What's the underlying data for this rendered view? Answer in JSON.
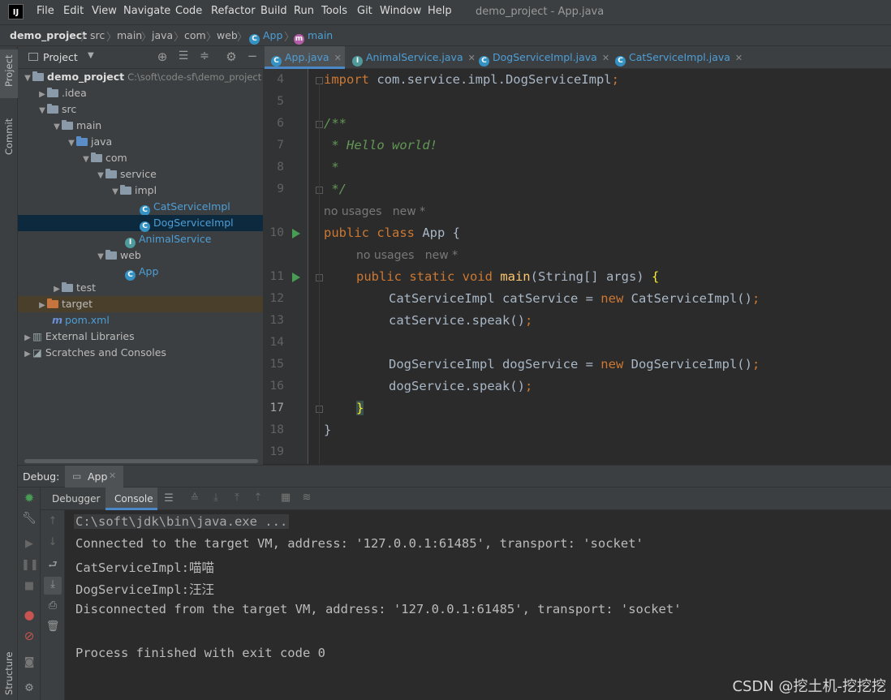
{
  "menu": {
    "items": [
      "File",
      "Edit",
      "View",
      "Navigate",
      "Code",
      "Refactor",
      "Build",
      "Run",
      "Tools",
      "Git",
      "Window",
      "Help"
    ],
    "window_title": "demo_project - App.java"
  },
  "breadcrumb": [
    "demo_project",
    "src",
    "main",
    "java",
    "com",
    "web",
    "App",
    "main"
  ],
  "side_tabs": {
    "project": "Project",
    "commit": "Commit",
    "structure": "Structure"
  },
  "project_panel": {
    "title": "Project",
    "tree": [
      {
        "label": "demo_project",
        "path": "C:\\soft\\code-sf\\demo_project"
      },
      {
        "label": ".idea"
      },
      {
        "label": "src"
      },
      {
        "label": "main"
      },
      {
        "label": "java"
      },
      {
        "label": "com"
      },
      {
        "label": "service"
      },
      {
        "label": "impl"
      },
      {
        "label": "CatServiceImpl"
      },
      {
        "label": "DogServiceImpl"
      },
      {
        "label": "AnimalService"
      },
      {
        "label": "web"
      },
      {
        "label": "App"
      },
      {
        "label": "test"
      },
      {
        "label": "target"
      },
      {
        "label": "pom.xml"
      },
      {
        "label": "External Libraries"
      },
      {
        "label": "Scratches and Consoles"
      }
    ]
  },
  "editor_tabs": [
    "App.java",
    "AnimalService.java",
    "DogServiceImpl.java",
    "CatServiceImpl.java"
  ],
  "editor": {
    "line_numbers": [
      "4",
      "5",
      "6",
      "7",
      "8",
      "9",
      "10",
      "11",
      "12",
      "13",
      "14",
      "15",
      "16",
      "17",
      "18",
      "19"
    ],
    "hints": {
      "usages": "no usages",
      "new": "new *"
    },
    "code": {
      "l4_kw": "import",
      "l4_rest": " com.service.impl.DogServiceImpl",
      "l6": "/**",
      "l7": " * Hello world!",
      "l8": " *",
      "l9": " */",
      "l10_kw": "public class",
      "l10_rest": " App {",
      "l11_kw": "public static void",
      "l11_fn": " main",
      "l11_rest": "(String[] args) ",
      "l11_brace": "{",
      "l12_a": "CatServiceImpl catService = ",
      "l12_kw": "new",
      "l12_b": " CatServiceImpl()",
      "l13": "catService.speak()",
      "l15_a": "DogServiceImpl dogService = ",
      "l15_kw": "new",
      "l15_b": " DogServiceImpl()",
      "l16": "dogService.speak()",
      "l17": "}",
      "l18": "}",
      "semicolon": ";"
    }
  },
  "debug": {
    "label": "Debug:",
    "session_tab": "App",
    "subtabs": [
      "Debugger",
      "Console"
    ],
    "console_lines": [
      "C:\\soft\\jdk\\bin\\java.exe ...",
      "Connected to the target VM, address: '127.0.0.1:61485', transport: 'socket'",
      "CatServiceImpl:喵喵",
      "DogServiceImpl:汪汪",
      "Disconnected from the target VM, address: '127.0.0.1:61485', transport: 'socket'",
      "",
      "Process finished with exit code 0"
    ]
  },
  "watermark": "CSDN @挖土机-挖挖挖"
}
